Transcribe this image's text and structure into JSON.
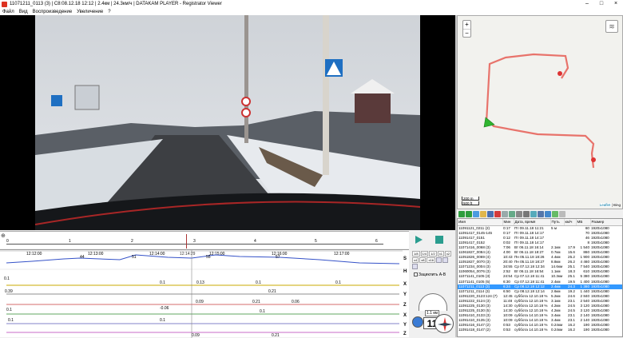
{
  "window": {
    "title": "11071211_0113 (3)  |  C8:08.12.18 12:12  |  2.4км  |  24.3км/ч  |  DATAKAM PLAYER - Registrator Viewer",
    "controls": [
      "–",
      "□",
      "×"
    ]
  },
  "menu": [
    "Файл",
    "Вид",
    "Воспроизведение",
    "Увеличение",
    "?"
  ],
  "colors": {
    "route": "#e8736b",
    "selected_row": "#3399ff",
    "accent": "#2a9d8f"
  },
  "map": {
    "zoom_in": "+",
    "zoom_out": "−",
    "scale_m": "200 m",
    "scale_ft": "500 ft",
    "attribution_link": "Leaflet",
    "attribution_text": " | Bing"
  },
  "timeline": {
    "ticks": [
      "0",
      "1",
      "2",
      "3",
      "4",
      "5",
      "6"
    ],
    "times": [
      "12:12:00",
      "12:13:00",
      "12:14:00",
      "12:15:00",
      "12:16:00",
      "12:17:00"
    ],
    "current": "12:14:29"
  },
  "graph_channels": [
    "S",
    "H",
    "X",
    "Y",
    "Z",
    "X",
    "Y",
    "Z"
  ],
  "graph_labels": {
    "s": [
      "44",
      "51",
      "55",
      "57"
    ],
    "h": [
      "0.1",
      "0.1",
      "0.13",
      "0.1",
      "0.1"
    ],
    "x": [
      "-0.06",
      "0.09",
      "0.21",
      "0.1",
      "0.06"
    ],
    "y": [
      "0.39",
      "0.21",
      "0.1",
      "0.1"
    ]
  },
  "controls": {
    "buttons": [
      "1/8",
      "1/4",
      "1/2",
      "x1",
      "x2",
      "x4",
      "x8",
      "x16"
    ],
    "checkbox": "Зациклить А-В",
    "speed": "11",
    "odometer": "1.1 км"
  },
  "filelist": {
    "columns": [
      "Имя",
      "Мин",
      "Дата, время",
      "Путь",
      "км/ч",
      "МБ",
      "Размер"
    ],
    "rows": [
      [
        "11091121_0211 (2)",
        "0:17",
        "Пт 09.11.18 11:21",
        "5 м",
        "",
        "60",
        "1920x1080"
      ],
      [
        "11091417_0145-145",
        "0:17",
        "Пт 09.11.18 14:17",
        "",
        "",
        "70",
        "1920x1080"
      ],
      [
        "11091417_0151",
        "0:12",
        "Пт 09.11.18 14:17",
        "",
        "",
        "46",
        "1920x1080"
      ],
      [
        "11091417_0152",
        "0:02",
        "Пт 09.11.18 14:17",
        "",
        "",
        "8",
        "1920x1080"
      ],
      [
        "11071416_0068 (3)",
        "7:06",
        "Вт 06.11.18 16:14",
        "2.1км",
        "17.9",
        "1 540",
        "1920x1080"
      ],
      [
        "11061827_0084 (4)",
        "4:00",
        "Вт 06.11.18 18:27",
        "0.7км",
        "15.6",
        "860",
        "1920x1080"
      ],
      [
        "11051826_0069 (4)",
        "10:43",
        "Пн 05.11.18 18:26",
        "4.4км",
        "25.2",
        "1 900",
        "1920x1080"
      ],
      [
        "11051827_0070 (3)",
        "20:40",
        "Пн 05.11.18 18:27",
        "8.8км",
        "26.2",
        "4 460",
        "1920x1080"
      ],
      [
        "11071234_0004 (3)",
        "34:55",
        "Ср 07.12.18 12:34",
        "14.6км",
        "25.1",
        "7 540",
        "1920x1080"
      ],
      [
        "11060054_0076 (3)",
        "2:52",
        "Вт 06.11.18 16:54",
        "1.1км",
        "18.3",
        "610",
        "1920x1080"
      ],
      [
        "11071141_0105 (3)",
        "24:54",
        "Ср 07.12.18 11:41",
        "10.3км",
        "25.1",
        "5 380",
        "1920x1080"
      ],
      [
        "11071141_0105 (5)",
        "6:30",
        "Ср 07.12.18 11:41",
        "2.4км",
        "19.5",
        "1 400",
        "1920x1080"
      ],
      [
        "11071211_0113 (3)",
        "6:24",
        "Ср 08.12.18 12:12",
        "2.4км",
        "24.3",
        "1 380",
        "1920x1080"
      ],
      [
        "11071211_0114 (3)",
        "6:50",
        "Ср 08.12.18 12:14",
        "2.6км",
        "19.2",
        "1 440",
        "1920x1080"
      ],
      [
        "11091220_0123:124 (7)",
        "12:45",
        "суббота 12.10.18 %",
        "5.2км",
        "24.6",
        "2 840",
        "1920x1080"
      ],
      [
        "11091222_0124 (3)",
        "11:48",
        "суббота 12.10.18 %",
        "3.1км",
        "23.1",
        "2 540",
        "1920x1080"
      ],
      [
        "11091225_0130 (3)",
        "14:30",
        "суббота 12.10.18 %",
        "4.2км",
        "24.5",
        "3 120",
        "1920x1080"
      ],
      [
        "11091225_0130 (5)",
        "14:30",
        "суббота 12.10.18 %",
        "4.2км",
        "24.5",
        "3 120",
        "1920x1080"
      ],
      [
        "11091410_0133 (3)",
        "10:09",
        "суббота 14.10.18 %",
        "3.4км",
        "23.1",
        "2 140",
        "1920x1080"
      ],
      [
        "11091410_0135 (3)",
        "10:09",
        "суббота 14.10.18 %",
        "3.4км",
        "23.1",
        "2 140",
        "1920x1080"
      ],
      [
        "11091416_0147 (2)",
        "0:53",
        "суббота 14.10.18 %",
        "0.24км",
        "16.2",
        "190",
        "1920x1080"
      ],
      [
        "11091418_0147 (2)",
        "0:53",
        "суббота 14.10.18 %",
        "0.24км",
        "16.2",
        "190",
        "1920x1080"
      ]
    ],
    "selected_index": 12
  }
}
